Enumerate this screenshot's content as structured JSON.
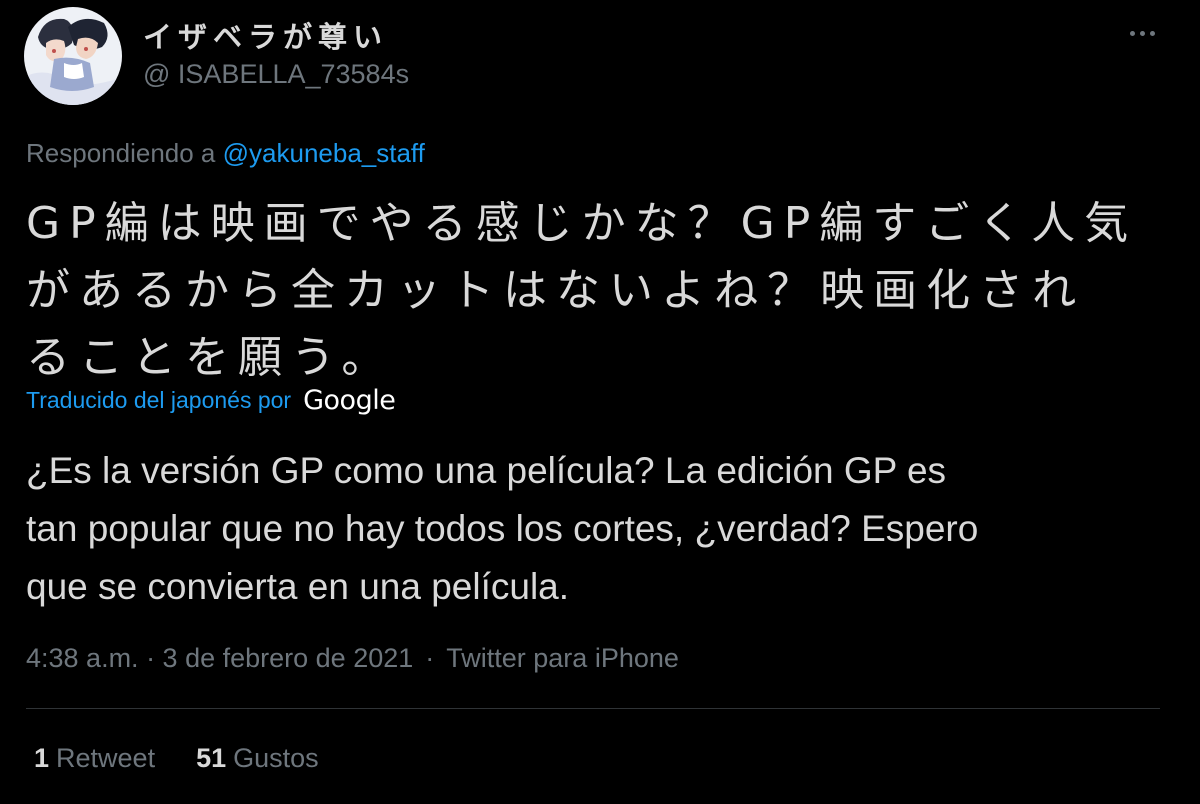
{
  "tweet": {
    "author": {
      "display_name": "イザベラが尊い",
      "handle": "@ ISABELLA_73584s"
    },
    "replying_to": {
      "prefix": "Respondiendo a",
      "mention": "@yakuneba_staff"
    },
    "text_original": "GP編は映画でやる感じかな？GP編すごく人気\nがあるから全カットはないよね？映画化され\nることを願う。",
    "translation": {
      "label": "Traducido del japonés por",
      "provider": "Google",
      "text": "¿Es la versión GP como una película? La edición GP es\ntan popular que no hay todos los cortes, ¿verdad? Espero\nque se convierta en una película."
    },
    "meta": {
      "timestamp": "4:38 a.m. · 3 de febrero de 2021",
      "separator": "·",
      "source": "Twitter para iPhone"
    },
    "stats": {
      "retweets_count": "1",
      "retweets_label": "Retweet",
      "likes_count": "51",
      "likes_label": "Gustos"
    }
  },
  "icons": {
    "more": "more-horizontal-icon",
    "avatar": "avatar-image"
  },
  "colors": {
    "background": "#000000",
    "text_primary": "#d9d9d9",
    "text_secondary": "#6e767d",
    "link": "#1d9bf0",
    "divider": "#2f3336"
  }
}
